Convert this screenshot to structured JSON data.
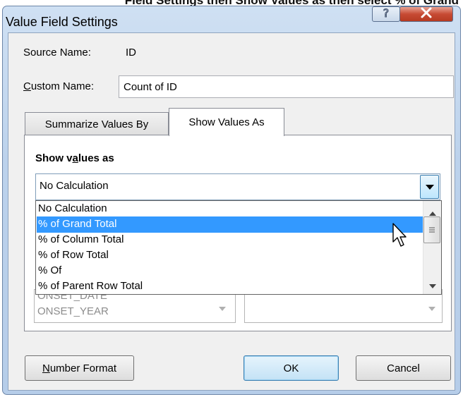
{
  "caption": "Field Settings then Show Values as then select % of Grand",
  "window": {
    "title": "Value Field Settings",
    "help_glyph": "?",
    "close_glyph": "X"
  },
  "source": {
    "label": "Source Name:",
    "value": "ID"
  },
  "custom_name": {
    "label_first": "C",
    "label_rest": "ustom Name:",
    "value": "Count of ID"
  },
  "tabs": [
    {
      "label": "Summarize Values By",
      "active": false
    },
    {
      "label": "Show Values As",
      "active": true
    }
  ],
  "show_values": {
    "heading_pre": "Show v",
    "heading_ul": "a",
    "heading_post": "lues as",
    "selected": "No Calculation",
    "options": [
      "No Calculation",
      "% of Grand Total",
      "% of Column Total",
      "% of Row Total",
      "% Of",
      "% of Parent Row Total"
    ],
    "highlighted": "% of Grand Total"
  },
  "base_field_list": [
    "ONSET_DATE",
    "ONSET_YEAR"
  ],
  "buttons": {
    "number_format_first": "N",
    "number_format_rest": "umber Format",
    "ok": "OK",
    "cancel": "Cancel"
  },
  "colors": {
    "selection": "#3399ff",
    "close": "#c74b34"
  }
}
